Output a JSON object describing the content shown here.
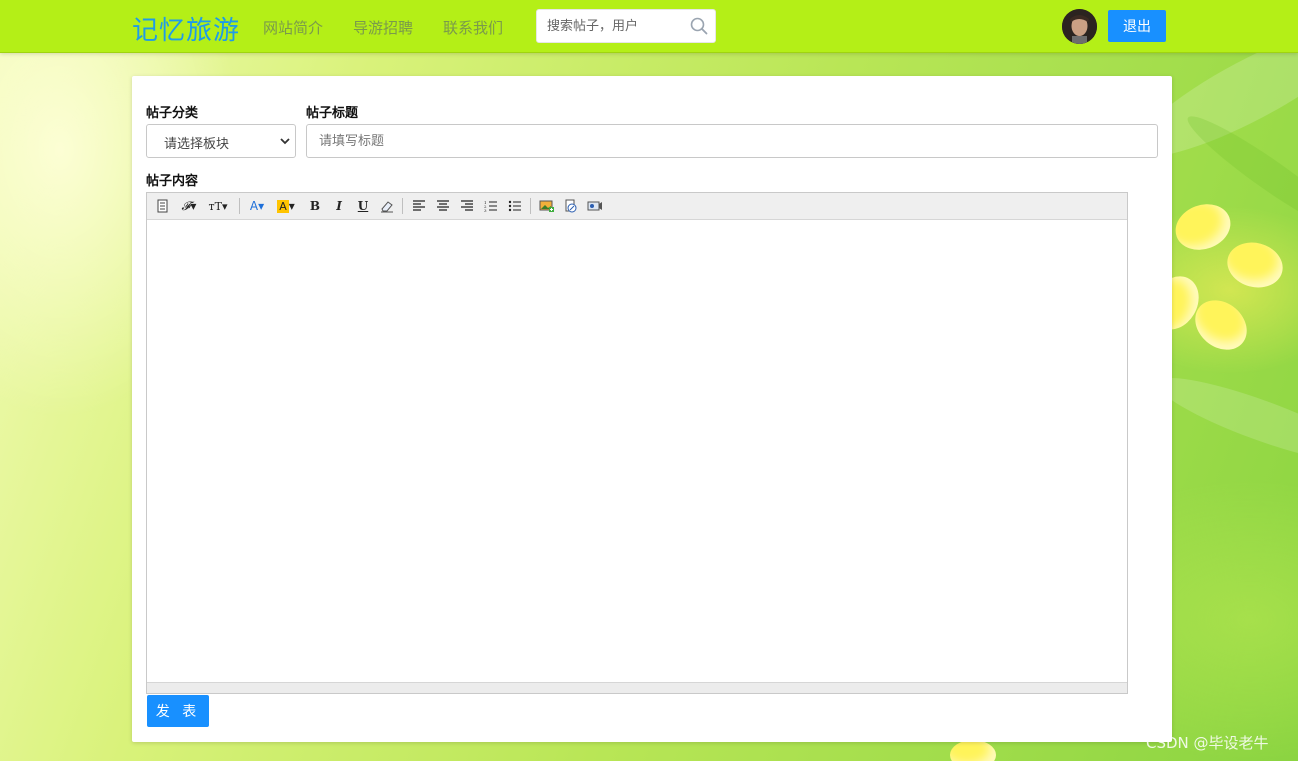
{
  "header": {
    "logo": "记忆旅游",
    "nav": [
      "网站简介",
      "导游招聘",
      "联系我们"
    ],
    "search_placeholder": "搜索帖子，用户",
    "logout_label": "退出"
  },
  "form": {
    "category_label": "帖子分类",
    "category_selected": "请选择板块",
    "title_label": "帖子标题",
    "title_placeholder": "请填写标题",
    "content_label": "帖子内容",
    "submit_label": "发 表"
  },
  "toolbar": {
    "buttons": [
      "source",
      "font-family",
      "font-size",
      "fore-color",
      "back-color",
      "bold",
      "italic",
      "underline",
      "remove-format",
      "justify-left",
      "justify-center",
      "justify-right",
      "ordered-list",
      "unordered-list",
      "insert-image",
      "insert-link",
      "insert-video"
    ]
  },
  "watermark": "CSDN @毕设老牛",
  "colors": {
    "header_bg": "#b4ef17",
    "accent": "#1890ff",
    "logo": "#1e9be9"
  }
}
